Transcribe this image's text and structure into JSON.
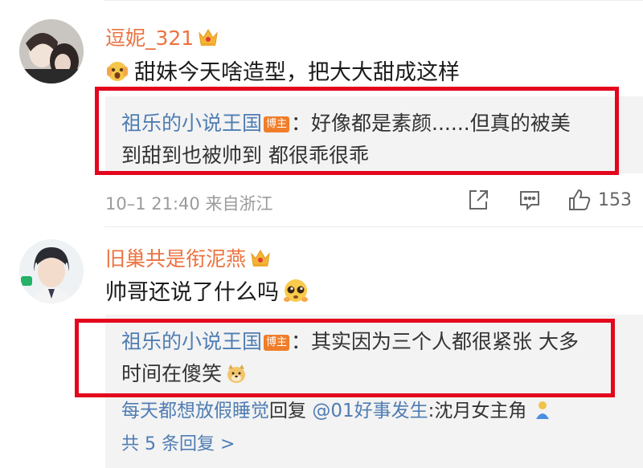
{
  "comments": [
    {
      "username": "逗妮_321",
      "text": "甜妹今天啥造型，把大大甜成这样",
      "reply": {
        "author": "祖乐的小说王国",
        "badge": "博主",
        "line1": "：好像都是素颜......但真的被美",
        "line2": "到甜到也被帅到 都很乖很乖"
      },
      "meta": "10–1 21:40  来自浙江",
      "likes": "153"
    },
    {
      "username": "旧巢共是衔泥燕",
      "text": "帅哥还说了什么吗",
      "reply": {
        "author": "祖乐的小说王国",
        "badge": "博主",
        "line1": "：其实因为三个人都很紧张 大多",
        "line2": "时间在傻笑"
      },
      "second_reply": {
        "author": "每天都想放假睡觉",
        "plain": "回复 ",
        "mention": "@01好事发生",
        "text": ":沈月女主角"
      },
      "more_replies": "共 5 条回复 >"
    }
  ],
  "colors": {
    "username": "#eb7340",
    "link": "#4f7db3",
    "badge": "#f07d2a",
    "highlight_box": "#e3061d",
    "reply_bg": "#f3f3f3"
  },
  "icons": [
    "crown-icon",
    "share-icon",
    "comment-icon",
    "like-icon"
  ]
}
